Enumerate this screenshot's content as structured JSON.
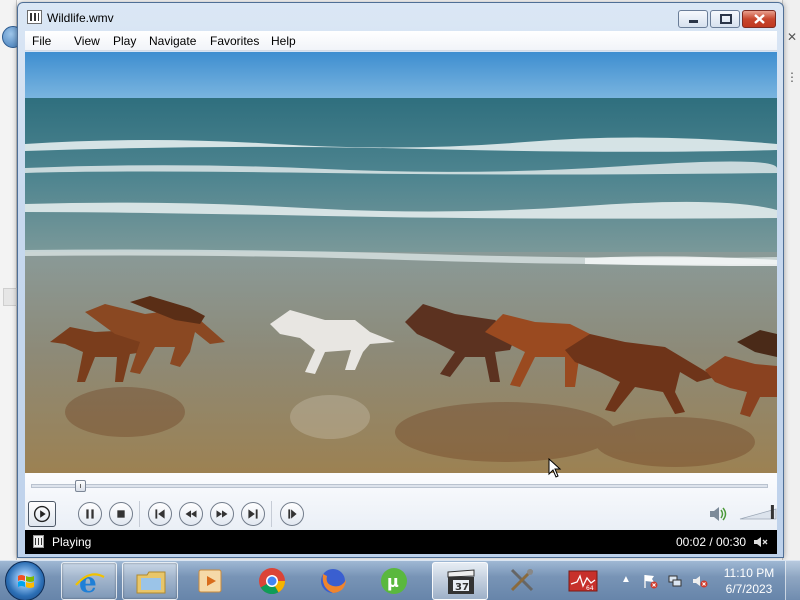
{
  "window": {
    "title": "Wildlife.wmv",
    "controls": {
      "minimize": "▭",
      "maximize": "▢",
      "close": "✕"
    }
  },
  "menubar": {
    "items": [
      "File",
      "View",
      "Play",
      "Navigate",
      "Favorites",
      "Help"
    ]
  },
  "player": {
    "seek_progress_fraction": 0.067,
    "volume_fraction": 0.9,
    "buttons": [
      "play",
      "pause",
      "stop",
      "previous",
      "rewind",
      "fast-forward",
      "next",
      "switch-to-library"
    ]
  },
  "statusbar": {
    "state": "Playing",
    "time": "00:02 / 00:30"
  },
  "taskbar": {
    "apps": [
      "internet-explorer",
      "windows-explorer",
      "media-player",
      "chrome",
      "firefox",
      "utorrent",
      "media-player-classic",
      "tools",
      "resource-monitor"
    ],
    "clock_time": "11:10 PM",
    "clock_date": "6/7/2023"
  },
  "colors": {
    "titlebar": "#c7d8ee",
    "statusbar": "#000000",
    "close_button": "#c8472e",
    "taskbar": "#7894b6"
  },
  "icons": {
    "speaker": "speaker-icon",
    "mute": "mute-icon",
    "start": "windows-flag-icon"
  }
}
